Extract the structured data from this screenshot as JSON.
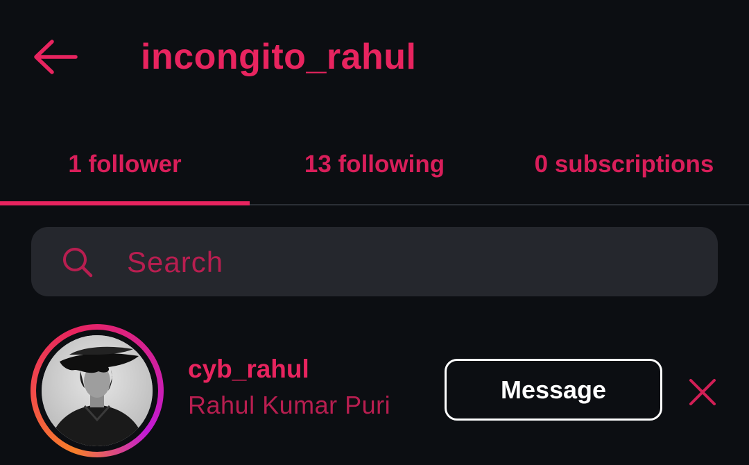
{
  "header": {
    "back_icon": "arrow-left-icon",
    "title": "incongito_rahul"
  },
  "tabs": [
    {
      "label": "1 follower",
      "active": true
    },
    {
      "label": "13 following",
      "active": false
    },
    {
      "label": "0 subscriptions",
      "active": false
    }
  ],
  "search": {
    "icon": "search-icon",
    "placeholder": "Search",
    "value": ""
  },
  "followers": [
    {
      "username": "cyb_rahul",
      "full_name": "Rahul Kumar Puri",
      "action_label": "Message",
      "remove_icon": "close-icon"
    }
  ],
  "colors": {
    "background": "#0c0e12",
    "accent": "#e8245f",
    "accent_dim": "#b81e50",
    "search_bg": "#25272d",
    "divider": "#2b2f36",
    "button_border": "#ffffff"
  }
}
